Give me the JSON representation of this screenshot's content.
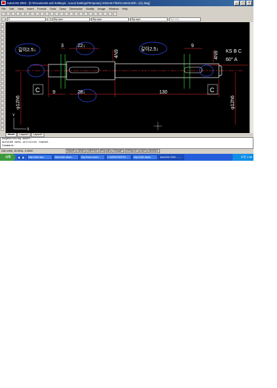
{
  "window": {
    "title": "AutoCAD 2002 - [C:\\Documents and Settings\\...\\Local Settings\\Temporary Internet Files\\Content.IE5\\...\\(1).dwg]",
    "controls": [
      "_",
      "□",
      "×"
    ]
  },
  "menu": [
    "File",
    "Edit",
    "View",
    "Insert",
    "Format",
    "Tools",
    "Draw",
    "Dimension",
    "Modify",
    "Image",
    "Window",
    "Help"
  ],
  "properties_bar": {
    "layer": "0",
    "color": "ByLayer",
    "linetype": "ByLayer",
    "lineweight": "ByLayer",
    "plotstyle": "ByColor"
  },
  "drawing": {
    "dims": {
      "depth_left": "깊이2.5↓",
      "d3": "3",
      "d22": "22↓",
      "d4n9_left": "4N9",
      "depth_right": "깊이2.5↓",
      "d9_top": "9",
      "d4n9_right": "4N9",
      "ksb": "KS B C",
      "angle": "60° A",
      "d9_bottom": "9",
      "d28": "28↓",
      "d130": "130",
      "phi_left": "φ12h6",
      "phi_right": "φ12h6",
      "label_c_left": "C",
      "label_c_right": "C"
    },
    "axis": {
      "x": "X",
      "y": "Y"
    }
  },
  "tabs": [
    "Model",
    "Layout1",
    "Layout2"
  ],
  "command": {
    "lines": [
      "Regenerating model.",
      "AutoCAD menu utilities loaded.",
      "Command:"
    ]
  },
  "status": {
    "coords": "246.1969, 10.9531, 0.0000",
    "modes": [
      "SNAP",
      "GRID",
      "ORTHO",
      "POLAR",
      "OSNAP",
      "OTRACK",
      "LWT",
      "MODEL"
    ]
  },
  "taskbar": {
    "start": "시작",
    "tasks": [
      "http://cafe.dau...",
      "http://cafe.daum...",
      "http://www.naver...",
      "C:\\WINDOWS\\TE...",
      "http://cafe.daum...",
      "AutoCAD 2002 - ..."
    ],
    "clock": "오전 1:58"
  }
}
